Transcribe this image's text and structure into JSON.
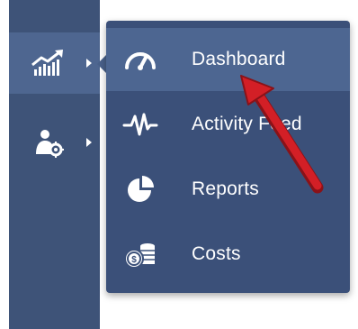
{
  "colors": {
    "sidebar_bg": "#3e5378",
    "sidebar_active_bg": "#4e6690",
    "flyout_bg": "#3b5079",
    "flyout_active_bg": "#4d6691",
    "text": "#ffffff",
    "pointer_arrow": "#d31f26"
  },
  "sidebar": {
    "items": [
      {
        "icon": "analytics-chart-icon",
        "active": true
      },
      {
        "icon": "user-settings-icon",
        "active": false
      }
    ]
  },
  "flyout": {
    "items": [
      {
        "label": "Dashboard",
        "icon": "speedometer-icon",
        "active": true
      },
      {
        "label": "Activity Feed",
        "icon": "pulse-icon",
        "active": false
      },
      {
        "label": "Reports",
        "icon": "pie-chart-icon",
        "active": false
      },
      {
        "label": "Costs",
        "icon": "coins-icon",
        "active": false
      }
    ]
  },
  "annotation": {
    "icon": "red-pointer-arrow-icon"
  }
}
